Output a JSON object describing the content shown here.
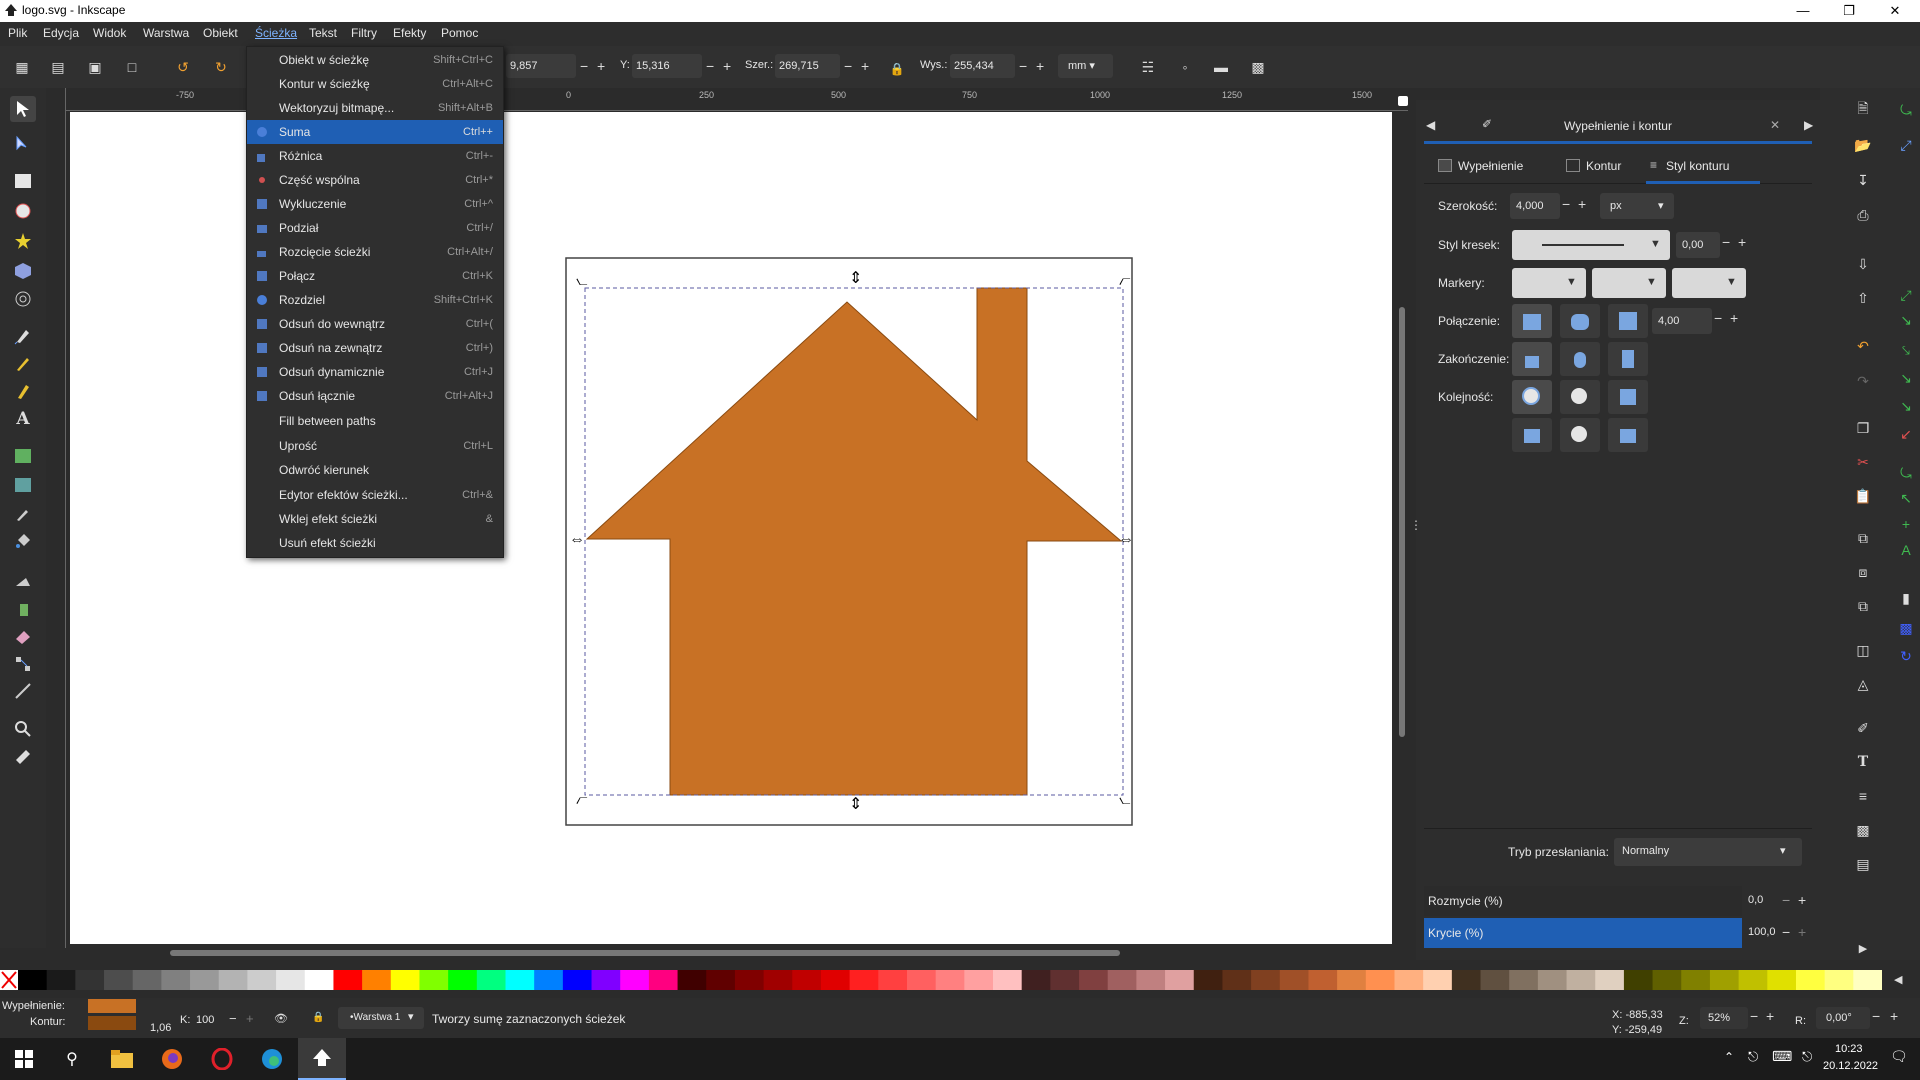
{
  "window": {
    "title": "logo.svg - Inkscape"
  },
  "menubar": {
    "items": [
      "Plik",
      "Edycja",
      "Widok",
      "Warstwa",
      "Obiekt",
      "Ścieżka",
      "Tekst",
      "Filtry",
      "Efekty",
      "Pomoc"
    ],
    "active": "Ścieżka"
  },
  "toolbar": {
    "x_value": "9,857",
    "y_label": "Y:",
    "y_value": "15,316",
    "w_label": "Szer.:",
    "w_value": "269,715",
    "h_label": "Wys.:",
    "h_value": "255,434",
    "unit": "mm"
  },
  "ruler": {
    "ticks": [
      "-750",
      "0",
      "250",
      "500",
      "750",
      "1000",
      "1250",
      "1500"
    ]
  },
  "path_menu": {
    "items": [
      {
        "label": "Obiekt w ścieżkę",
        "shortcut": "Shift+Ctrl+C"
      },
      {
        "label": "Kontur w ścieżkę",
        "shortcut": "Ctrl+Alt+C"
      },
      {
        "label": "Wektoryzuj bitmapę...",
        "shortcut": "Shift+Alt+B"
      },
      {
        "label": "Suma",
        "shortcut": "Ctrl++"
      },
      {
        "label": "Różnica",
        "shortcut": "Ctrl+-"
      },
      {
        "label": "Część wspólna",
        "shortcut": "Ctrl+*"
      },
      {
        "label": "Wykluczenie",
        "shortcut": "Ctrl+^"
      },
      {
        "label": "Podział",
        "shortcut": "Ctrl+/"
      },
      {
        "label": "Rozcięcie ścieżki",
        "shortcut": "Ctrl+Alt+/"
      },
      {
        "label": "Połącz",
        "shortcut": "Ctrl+K"
      },
      {
        "label": "Rozdziel",
        "shortcut": "Shift+Ctrl+K"
      },
      {
        "label": "Odsuń do wewnątrz",
        "shortcut": "Ctrl+("
      },
      {
        "label": "Odsuń na zewnątrz",
        "shortcut": "Ctrl+)"
      },
      {
        "label": "Odsuń dynamicznie",
        "shortcut": "Ctrl+J"
      },
      {
        "label": "Odsuń łącznie",
        "shortcut": "Ctrl+Alt+J"
      },
      {
        "label": "Fill between paths",
        "shortcut": ""
      },
      {
        "label": "Uprość",
        "shortcut": "Ctrl+L"
      },
      {
        "label": "Odwróć kierunek",
        "shortcut": ""
      },
      {
        "label": "Edytor efektów ścieżki...",
        "shortcut": "Ctrl+&"
      },
      {
        "label": "Wklej efekt ścieżki",
        "shortcut": "&"
      },
      {
        "label": "Usuń efekt ścieżki",
        "shortcut": ""
      }
    ],
    "highlighted": "Suma"
  },
  "dock": {
    "title": "Wypełnienie i kontur",
    "tabs": [
      "Wypełnienie",
      "Kontur",
      "Styl konturu"
    ],
    "active_tab": "Styl konturu",
    "width_label": "Szerokość:",
    "width_value": "4,000",
    "width_unit": "px",
    "dash_label": "Styl kresek:",
    "dash_offset": "0,00",
    "markers_label": "Markery:",
    "join_label": "Połączenie:",
    "miter_value": "4,00",
    "cap_label": "Zakończenie:",
    "order_label": "Kolejność:",
    "blend_label": "Tryb przesłaniania:",
    "blend_value": "Normalny",
    "blur_label": "Rozmycie (%)",
    "blur_value": "0,0",
    "opacity_label": "Krycie (%)",
    "opacity_value": "100,0"
  },
  "status": {
    "fill_label": "Wypełnienie:",
    "stroke_label": "Kontur:",
    "stroke_width": "1,06",
    "k_label": "K:",
    "k_value": "100",
    "layer": "•Warstwa 1",
    "message": "Tworzy sumę zaznaczonych ścieżek",
    "x_coord": "X: -885,33",
    "y_coord": "Y: -259,49",
    "zoom_label": "Z:",
    "zoom": "52%",
    "rot_label": "R:",
    "rotation": "0,00°"
  },
  "colors": {
    "house_fill": "#c87125",
    "stroke": "#8a4a10",
    "accent": "#1f5fb4"
  },
  "taskbar": {
    "time": "10:23",
    "date": "20.12.2022"
  }
}
